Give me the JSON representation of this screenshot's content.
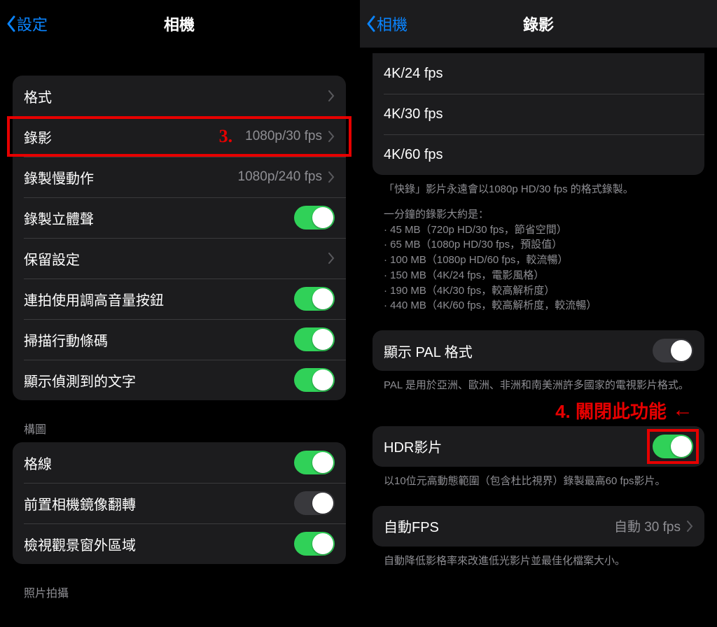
{
  "left": {
    "back_label": "設定",
    "title": "相機",
    "group1": {
      "format": "格式",
      "video": {
        "label": "錄影",
        "value": "1080p/30 fps"
      },
      "slomo": {
        "label": "錄製慢動作",
        "value": "1080p/240 fps"
      },
      "stereo": "錄製立體聲",
      "preserve": "保留設定",
      "burst_volume": "連拍使用調高音量按鈕",
      "scan_qr": "掃描行動條碼",
      "show_text": "顯示偵測到的文字"
    },
    "group2_head": "構圖",
    "group2": {
      "grid": "格線",
      "mirror": "前置相機鏡像翻轉",
      "outside": "檢視觀景窗外區域"
    },
    "group3_head": "照片拍攝"
  },
  "right": {
    "back_label": "相機",
    "title": "錄影",
    "resolutions": [
      "4K/24 fps",
      "4K/30 fps",
      "4K/60 fps"
    ],
    "quick_note": "「快錄」影片永遠會以1080p HD/30 fps 的格式錄製。",
    "minute_head": "一分鐘的錄影大約是：",
    "minute_lines": [
      "· 45 MB（720p HD/30 fps，節省空間）",
      "· 65 MB（1080p HD/30 fps，預設值）",
      "· 100 MB（1080p HD/60 fps，較流暢）",
      "· 150 MB（4K/24 fps，電影風格）",
      "· 190 MB（4K/30 fps，較高解析度）",
      "· 440 MB（4K/60 fps，較高解析度，較流暢）"
    ],
    "pal": {
      "label": "顯示 PAL 格式",
      "foot": "PAL 是用於亞洲、歐洲、非洲和南美洲許多國家的電視影片格式。"
    },
    "hdr": {
      "label": "HDR影片",
      "foot": "以10位元高動態範圍（包含杜比視界）錄製最高60 fps影片。"
    },
    "auto_fps": {
      "label": "自動FPS",
      "value": "自動 30 fps",
      "foot": "自動降低影格率來改進低光影片並最佳化檔案大小。"
    }
  },
  "annotations": {
    "step3": "3.",
    "step4_text": "4. 關閉此功能",
    "arrow": "←"
  }
}
